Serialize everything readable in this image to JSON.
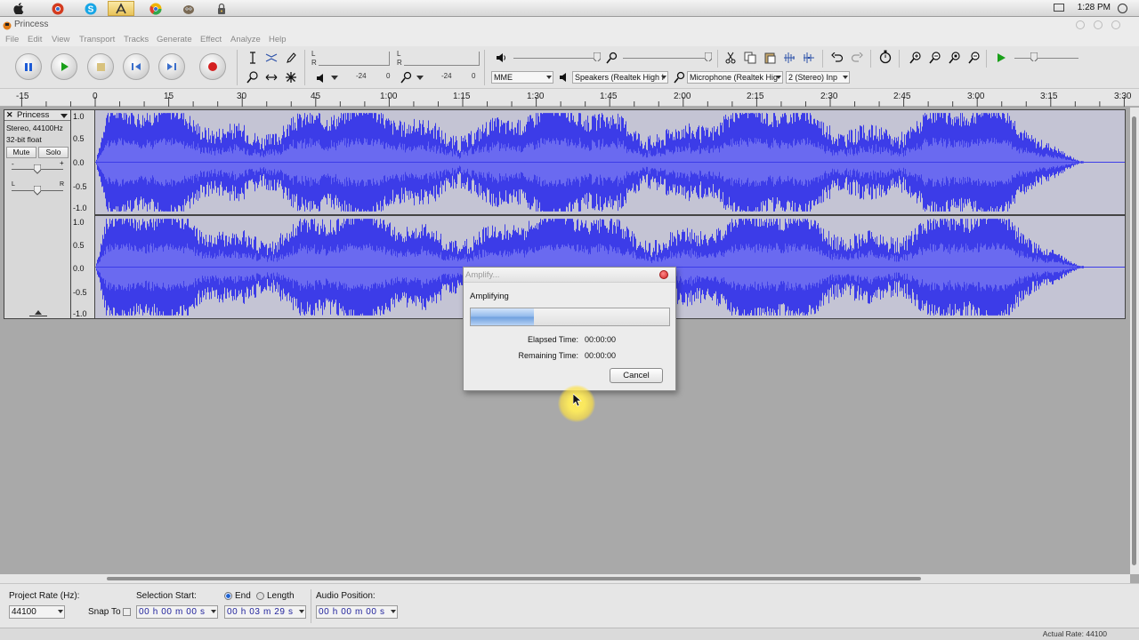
{
  "dock": {
    "apps": [
      {
        "name": "apple-menu-icon"
      },
      {
        "name": "chrome-red-icon"
      },
      {
        "name": "skype-icon"
      },
      {
        "name": "audacity-icon"
      },
      {
        "name": "chrome-icon"
      },
      {
        "name": "gimp-icon"
      },
      {
        "name": "lock-icon"
      }
    ],
    "clock": "1:28 PM"
  },
  "window": {
    "title": "Princess"
  },
  "menu": [
    "File",
    "Edit",
    "View",
    "Transport",
    "Tracks",
    "Generate",
    "Effect",
    "Analyze",
    "Help"
  ],
  "meters": {
    "play": {
      "l": "L",
      "r": "R",
      "ticks": [
        "-24",
        "0"
      ]
    },
    "record": {
      "l": "L",
      "r": "R",
      "ticks": [
        "-24",
        "0"
      ]
    }
  },
  "devices": {
    "host": "MME",
    "output": "Speakers (Realtek High I",
    "input": "Microphone (Realtek Hig",
    "channels": "2 (Stereo) Inp"
  },
  "timeline": {
    "labels": [
      "-15",
      "0",
      "15",
      "30",
      "45",
      "1:00",
      "1:15",
      "1:30",
      "1:45",
      "2:00",
      "2:15",
      "2:30",
      "2:45",
      "3:00",
      "3:15",
      "3:30"
    ]
  },
  "track": {
    "name": "Princess",
    "format": "Stereo, 44100Hz",
    "bits": "32-bit float",
    "mute": "Mute",
    "solo": "Solo",
    "gain_minus": "-",
    "gain_plus": "+",
    "pan_l": "L",
    "pan_r": "R",
    "ruler": [
      "1.0",
      "0.5",
      "0.0",
      "-0.5",
      "-1.0"
    ],
    "wave_color": "#3c3ce8",
    "wave_bg": "#c4c4d4"
  },
  "dialog": {
    "title": "Amplify...",
    "message": "Amplifying",
    "progress": 0.32,
    "elapsed_label": "Elapsed Time:",
    "elapsed_value": "00:00:00",
    "remaining_label": "Remaining Time:",
    "remaining_value": "00:00:00",
    "cancel": "Cancel"
  },
  "selection": {
    "project_rate_label": "Project Rate (Hz):",
    "project_rate": "44100",
    "snap_to": "Snap To",
    "selection_start_label": "Selection Start:",
    "end_label": "End",
    "length_label": "Length",
    "audio_position_label": "Audio Position:",
    "start_value": "00 h 00 m 00 s",
    "end_value": "00 h 03 m 29 s",
    "position_value": "00 h 00 m 00 s"
  },
  "status": {
    "actual_rate": "Actual Rate: 44100"
  }
}
